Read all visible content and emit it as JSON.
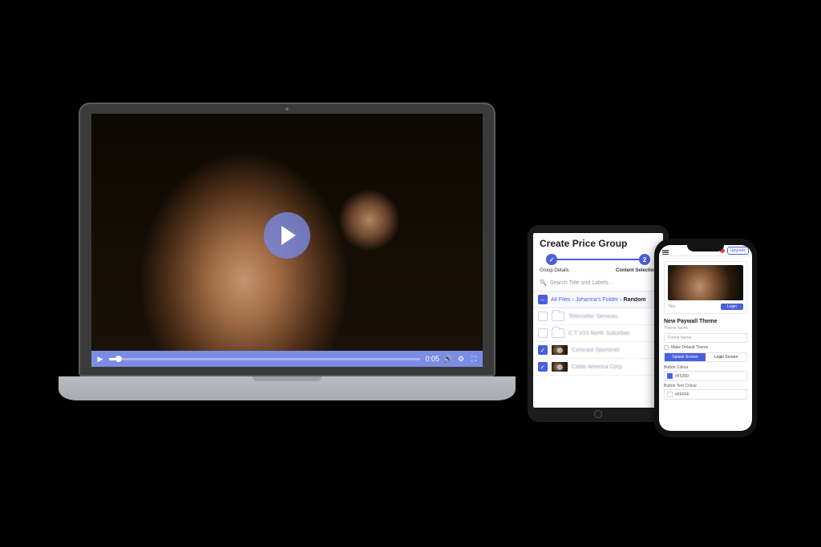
{
  "colors": {
    "accent": "#4a5fdc"
  },
  "video": {
    "time_label": "0:05",
    "play_icon_name": "play-icon",
    "controls": {
      "play_icon": "▶",
      "volume_icon": "🔊",
      "cog_icon": "⚙",
      "fullscreen_icon": "⛶"
    }
  },
  "tablet": {
    "title": "Create Price Group",
    "steps": {
      "step1_label": "Group Details",
      "step2_label": "Content Selection",
      "step1_glyph": "✓",
      "step2_glyph": "2"
    },
    "search_placeholder": "Search Title and Labels…",
    "breadcrumb": {
      "all_files": "All Files",
      "folder": "Johanna's Folder",
      "current": "Random",
      "sep": "›"
    },
    "rows": [
      {
        "checked": false,
        "type": "folder",
        "label": "Telecrafter Services"
      },
      {
        "checked": false,
        "type": "folder",
        "label": "C T V15 North Suburban"
      },
      {
        "checked": true,
        "type": "video",
        "label": "Comcast Sportsnet"
      },
      {
        "checked": true,
        "type": "video",
        "label": "Cable America Corp"
      }
    ]
  },
  "phone": {
    "upgrade_label": "Upgrade",
    "preview": {
      "title_hint": "Title",
      "login_label": "Login"
    },
    "heading": "New Paywall Theme",
    "theme_name_label": "Theme Name",
    "theme_name_placeholder": "Theme Name",
    "default_checkbox_label": "Make Default Theme",
    "segments": {
      "splash": "Splash Screen",
      "login": "Login Screen"
    },
    "button_colour_label": "Button Colour",
    "button_colour_value": "#F5250",
    "button_text_colour_label": "Button Text Colour",
    "button_text_colour_value": "#FFFFF"
  }
}
